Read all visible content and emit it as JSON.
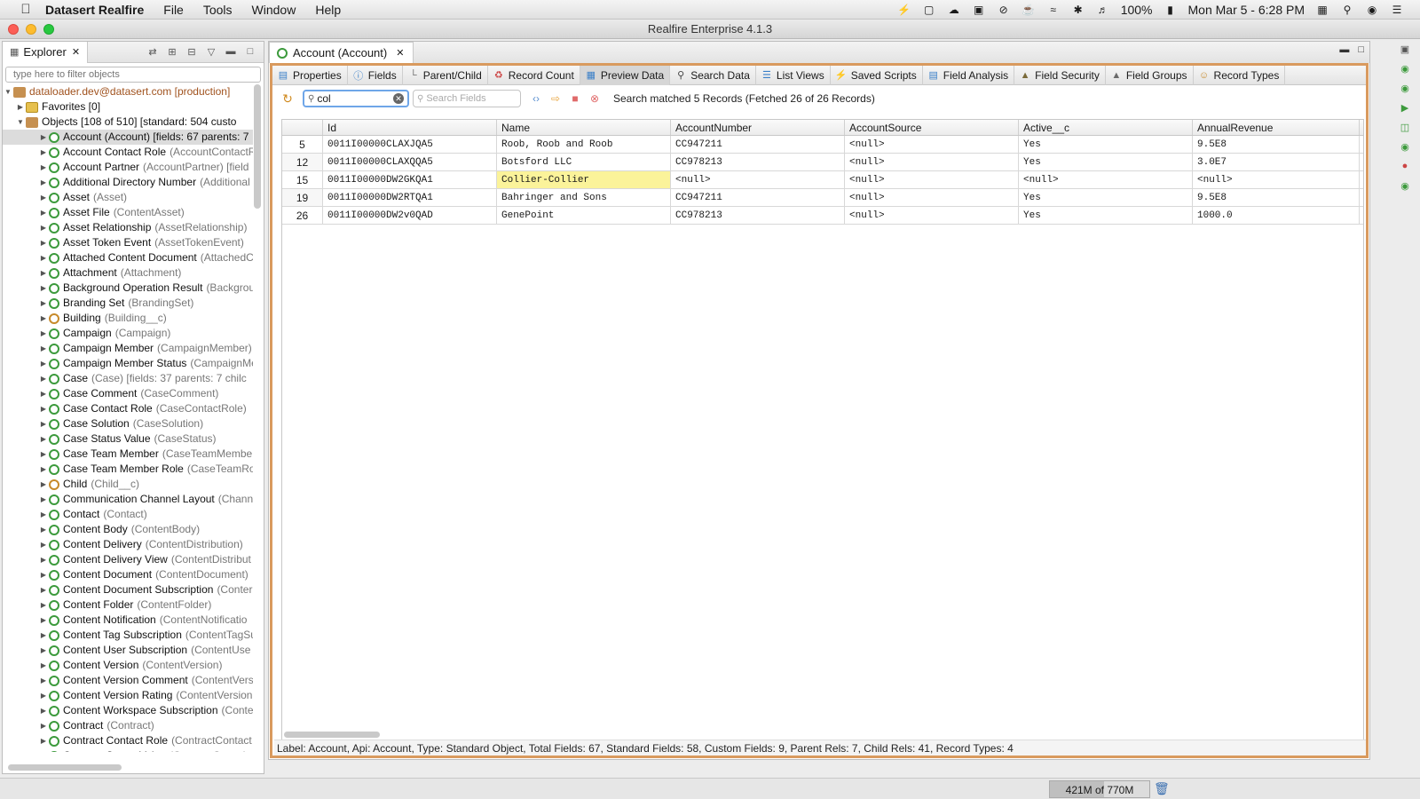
{
  "menubar": {
    "app_name": "Datasert Realfire",
    "items": [
      "File",
      "Tools",
      "Window",
      "Help"
    ],
    "battery": "100%",
    "clock": "Mon Mar 5 - 6:28 PM"
  },
  "window": {
    "title": "Realfire Enterprise 4.1.3"
  },
  "explorer": {
    "tab_label": "Explorer",
    "filter_placeholder": "type here to filter objects",
    "connection": "dataloader.dev@datasert.com [production]",
    "favorites": "Favorites [0]",
    "objects_header": "Objects [108 of 510] [standard: 504  custo",
    "objects": [
      {
        "name": "Account (Account) [fields: 67  parents: 7",
        "api": ""
      },
      {
        "name": "Account Contact Role",
        "api": "(AccountContactR"
      },
      {
        "name": "Account Partner",
        "api": "(AccountPartner) [field"
      },
      {
        "name": "Additional Directory Number",
        "api": "(Additional"
      },
      {
        "name": "Asset",
        "api": "(Asset)"
      },
      {
        "name": "Asset File",
        "api": "(ContentAsset)"
      },
      {
        "name": "Asset Relationship",
        "api": "(AssetRelationship)"
      },
      {
        "name": "Asset Token Event",
        "api": "(AssetTokenEvent)"
      },
      {
        "name": "Attached Content Document",
        "api": "(AttachedC"
      },
      {
        "name": "Attachment",
        "api": "(Attachment)"
      },
      {
        "name": "Background Operation Result",
        "api": "(Backgrou"
      },
      {
        "name": "Branding Set",
        "api": "(BrandingSet)"
      },
      {
        "name": "Building",
        "api": "(Building__c)"
      },
      {
        "name": "Campaign",
        "api": "(Campaign)"
      },
      {
        "name": "Campaign Member",
        "api": "(CampaignMember)"
      },
      {
        "name": "Campaign Member Status",
        "api": "(CampaignMe"
      },
      {
        "name": "Case",
        "api": "(Case) [fields: 37  parents: 7  chilc"
      },
      {
        "name": "Case Comment",
        "api": "(CaseComment)"
      },
      {
        "name": "Case Contact Role",
        "api": "(CaseContactRole)"
      },
      {
        "name": "Case Solution",
        "api": "(CaseSolution)"
      },
      {
        "name": "Case Status Value",
        "api": "(CaseStatus)"
      },
      {
        "name": "Case Team Member",
        "api": "(CaseTeamMember)"
      },
      {
        "name": "Case Team Member Role",
        "api": "(CaseTeamRole"
      },
      {
        "name": "Child",
        "api": "(Child__c)"
      },
      {
        "name": "Communication Channel Layout",
        "api": "(Channe"
      },
      {
        "name": "Contact",
        "api": "(Contact)"
      },
      {
        "name": "Content Body",
        "api": "(ContentBody)"
      },
      {
        "name": "Content Delivery",
        "api": "(ContentDistribution)"
      },
      {
        "name": "Content Delivery View",
        "api": "(ContentDistribut"
      },
      {
        "name": "Content Document",
        "api": "(ContentDocument)"
      },
      {
        "name": "Content Document Subscription",
        "api": "(Conter"
      },
      {
        "name": "Content Folder",
        "api": "(ContentFolder)"
      },
      {
        "name": "Content Notification",
        "api": "(ContentNotificatio"
      },
      {
        "name": "Content Tag Subscription",
        "api": "(ContentTagSu"
      },
      {
        "name": "Content User Subscription",
        "api": "(ContentUse"
      },
      {
        "name": "Content Version",
        "api": "(ContentVersion)"
      },
      {
        "name": "Content Version Comment",
        "api": "(ContentVers"
      },
      {
        "name": "Content Version Rating",
        "api": "(ContentVersion"
      },
      {
        "name": "Content Workspace Subscription",
        "api": "(Conte"
      },
      {
        "name": "Contract",
        "api": "(Contract)"
      },
      {
        "name": "Contract Contact Role",
        "api": "(ContractContact"
      },
      {
        "name": "Contract Status Value",
        "api": "(ContractStatus)"
      }
    ]
  },
  "editor": {
    "tab_label": "Account (Account)",
    "subtabs": [
      {
        "label": "Properties",
        "icon": "list-icon"
      },
      {
        "label": "Fields",
        "icon": "info-icon"
      },
      {
        "label": "Parent/Child",
        "icon": "hierarchy-icon"
      },
      {
        "label": "Record Count",
        "icon": "count-icon"
      },
      {
        "label": "Preview Data",
        "icon": "table-icon"
      },
      {
        "label": "Search Data",
        "icon": "search-icon"
      },
      {
        "label": "List Views",
        "icon": "list-lines-icon"
      },
      {
        "label": "Saved Scripts",
        "icon": "bolt-icon"
      },
      {
        "label": "Field Analysis",
        "icon": "chart-icon"
      },
      {
        "label": "Field Security",
        "icon": "shield-icon"
      },
      {
        "label": "Field Groups",
        "icon": "groups-icon"
      },
      {
        "label": "Record Types",
        "icon": "user-icon"
      }
    ],
    "search_value": "col",
    "field_search_placeholder": "Search Fields",
    "search_message": "Search matched 5 Records (Fetched 26 of 26 Records)",
    "columns": [
      "",
      "Id",
      "Name",
      "AccountNumber",
      "AccountSource",
      "Active__c",
      "AnnualRevenue"
    ],
    "rows": [
      [
        "5",
        "0011I00000CLAXJQA5",
        "Roob, Roob and Roob",
        "CC947211",
        "<null>",
        "Yes",
        "9.5E8"
      ],
      [
        "12",
        "0011I00000CLAXQQA5",
        "Botsford LLC",
        "CC978213",
        "<null>",
        "Yes",
        "3.0E7"
      ],
      [
        "15",
        "0011I00000DW2GKQA1",
        "Collier-Collier",
        "<null>",
        "<null>",
        "<null>",
        "<null>"
      ],
      [
        "19",
        "0011I00000DW2RTQA1",
        "Bahringer and Sons",
        "CC947211",
        "<null>",
        "Yes",
        "9.5E8"
      ],
      [
        "26",
        "0011I00000DW2v0QAD",
        "GenePoint",
        "CC978213",
        "<null>",
        "Yes",
        "1000.0"
      ]
    ],
    "highlighted_cell": {
      "row": 2,
      "col": 2,
      "color": "#fbf39a"
    },
    "info_line": "Label: Account, Api: Account, Type: Standard Object, Total Fields: 67, Standard Fields: 58, Custom Fields: 9, Parent Rels: 7, Child Rels: 41, Record Types: 4"
  },
  "status": {
    "memory": "421M of 770M",
    "memory_used_fraction": 0.547
  },
  "colors": {
    "accent_frame": "#d99a5e",
    "object_icon": "#3c9a3c",
    "search_focus": "#6fa6e8"
  }
}
